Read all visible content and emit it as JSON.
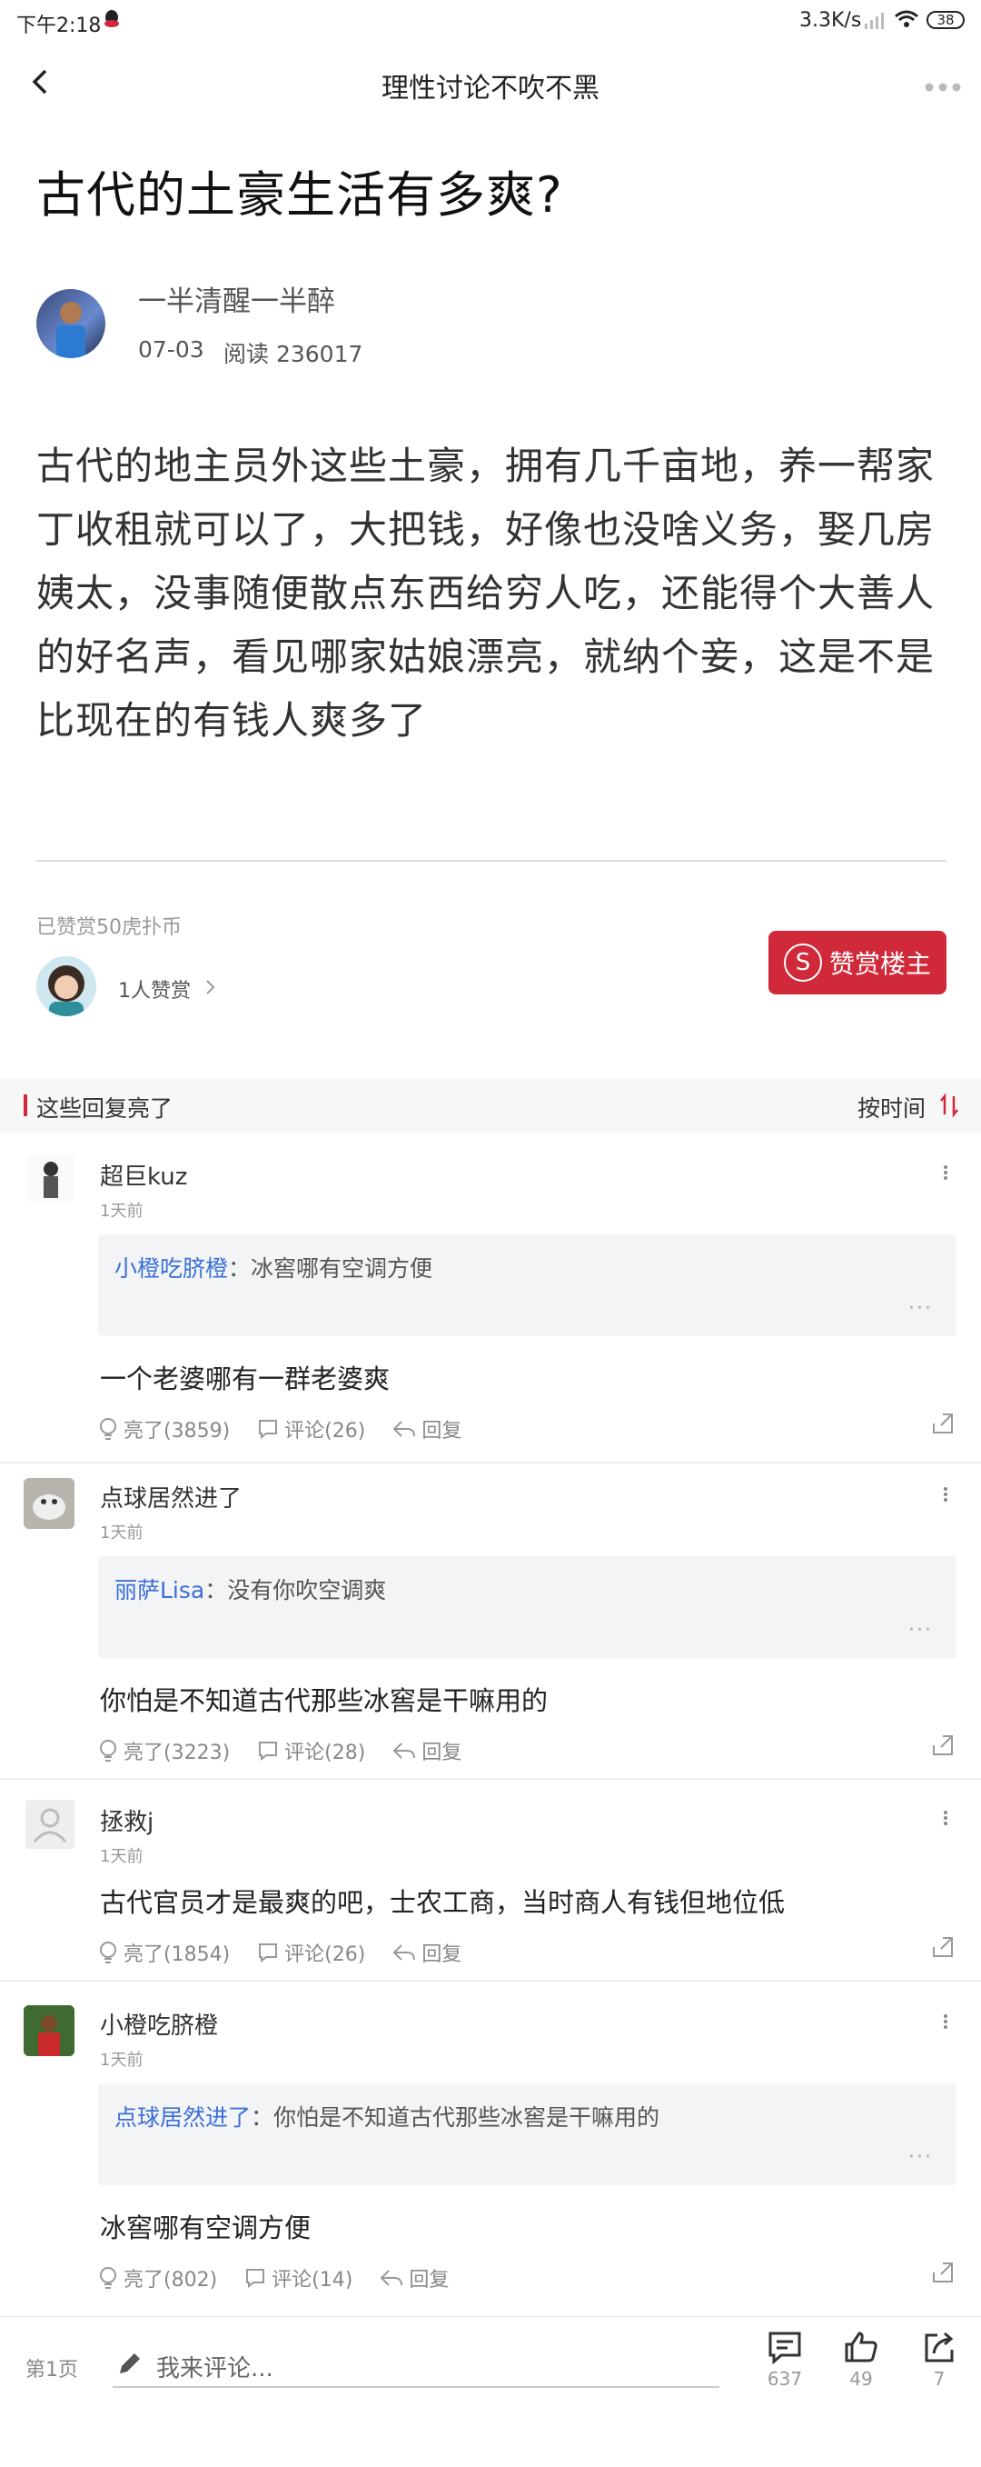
{
  "status": {
    "time": "下午2:18",
    "speed": "3.3K/s",
    "battery": "38"
  },
  "topbar": {
    "title": "理性讨论不吹不黑"
  },
  "post": {
    "title": "古代的土豪生活有多爽?",
    "author": "一半清醒一半醉",
    "date": "07-03",
    "reads": "阅读 236017",
    "body": "古代的地主员外这些土豪，拥有几千亩地，养一帮家丁收租就可以了，大把钱，好像也没啥义务，娶几房姨太，没事随便散点东西给穷人吃，还能得个大善人的好名声，看见哪家姑娘漂亮，就纳个妾，这是不是比现在的有钱人爽多了"
  },
  "reward": {
    "info": "已赞赏50虎扑币",
    "count": "1人赞赏",
    "button": "赞赏楼主",
    "button_icon": "S"
  },
  "section": {
    "title": "这些回复亮了",
    "sort": "按时间"
  },
  "comments": [
    {
      "name": "超巨kuz",
      "time": "1天前",
      "quote_user": "小橙吃脐橙",
      "quote_text": "：冰窖哪有空调方便",
      "text": "一个老婆哪有一群老婆爽",
      "likes": "亮了(3859)",
      "replies": "评论(26)",
      "reply": "回复"
    },
    {
      "name": "点球居然进了",
      "time": "1天前",
      "quote_user": "丽萨Lisa",
      "quote_text": "：没有你吹空调爽",
      "text": "你怕是不知道古代那些冰窖是干嘛用的",
      "likes": "亮了(3223)",
      "replies": "评论(28)",
      "reply": "回复"
    },
    {
      "name": "拯救j",
      "time": "1天前",
      "text": "古代官员才是最爽的吧，士农工商，当时商人有钱但地位低",
      "likes": "亮了(1854)",
      "replies": "评论(26)",
      "reply": "回复"
    },
    {
      "name": "小橙吃脐橙",
      "time": "1天前",
      "quote_user": "点球居然进了",
      "quote_text": "：你怕是不知道古代那些冰窖是干嘛用的",
      "text": "冰窖哪有空调方便",
      "likes": "亮了(802)",
      "replies": "评论(14)",
      "reply": "回复"
    }
  ],
  "quote_more": "···",
  "bottom": {
    "page": "第1页",
    "placeholder": "我来评论...",
    "comments": "637",
    "likes": "49",
    "shares": "7"
  },
  "colors": {
    "accent": "#d0293a",
    "link": "#3b6fd8"
  }
}
